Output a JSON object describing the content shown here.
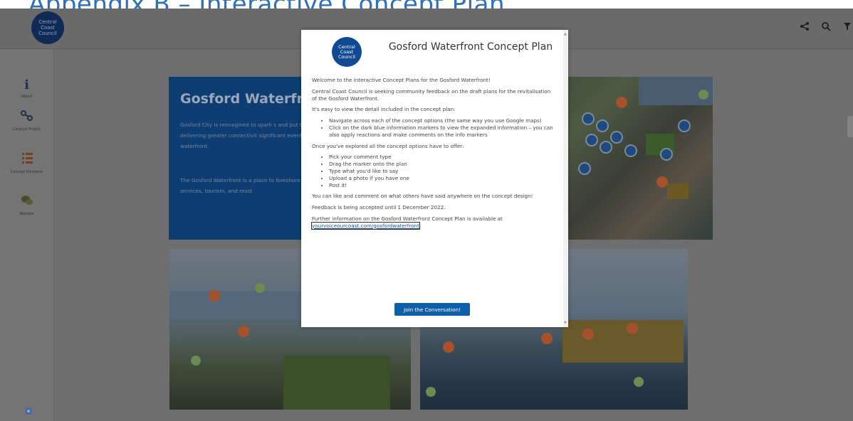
{
  "appendix": {
    "title": "Appendix B – Interactive Concept Plan"
  },
  "header": {
    "logo_lines": [
      "Central",
      "Coast",
      "Council"
    ],
    "icons": [
      "share-icon",
      "search-icon",
      "filter-icon"
    ]
  },
  "sidebar": {
    "items": [
      {
        "label": "About",
        "icon": "info-icon"
      },
      {
        "label": "Catalyst Project",
        "icon": "catalyst-icon"
      },
      {
        "label": "Concept Elements",
        "icon": "list-icon"
      },
      {
        "label": "Markers",
        "icon": "comments-icon"
      }
    ]
  },
  "card": {
    "heading": "Gosford Waterfron",
    "p1": "Gosford City is reimagined to spark s and put the Central Coast on the ma region, delivering greater connectivit significant events, and enhancing liv with a premiere waterfront.",
    "p2": "The Gosford Waterfront is a place fo foreshore with high quality public do maritime services, tourism, and resid"
  },
  "modal": {
    "logo_lines": [
      "Central",
      "Coast",
      "Council"
    ],
    "title": "Gosford Waterfront Concept Plan",
    "welcome": "Welcome to the interactive Concept Plans for the Gosford Waterfront!",
    "intro": "Central Coast Council is seeking community feedback on the draft plans for the revitalisation of the Gosford Waterfront.",
    "easy": "It's easy to view the detail included in the concept plan:",
    "bullets1": [
      "Navigate across each of the concept options (the same way you use Google maps)",
      "Click on the dark blue information markers to view the expanded information – you can also apply reactions and make comments on the info markers"
    ],
    "explored": "Once you've explored all the concept options have to offer:",
    "bullets2": [
      "Pick your comment type",
      "Drag the marker onto the plan",
      "Type what you'd like to say",
      "Upload a photo if you have one",
      "Post it!"
    ],
    "like": "You can like and comment on what others have said anywhere on the concept design!",
    "feedback": "Feedback is being accepted until 1 December 2022.",
    "further": "Further information on the Gosford Waterfront Concept Plan is available at",
    "link": "yourvoiceourcoast.com/gosfordwaterfront",
    "button": "Join the Conversation!"
  }
}
